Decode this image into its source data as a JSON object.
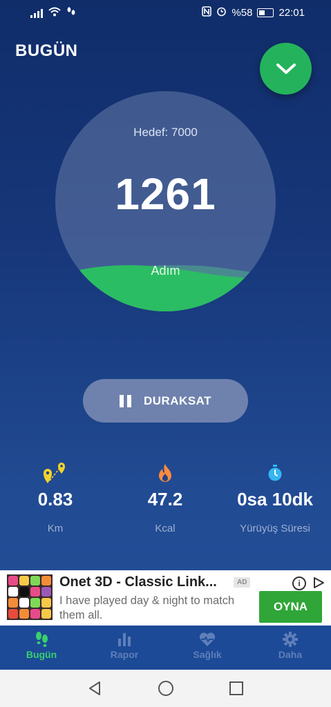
{
  "status_bar": {
    "battery_text": "%58",
    "time": "22:01",
    "icons": [
      "signal-icon",
      "wifi-icon",
      "steps-notification-icon",
      "nfc-icon",
      "alarm-icon",
      "battery-icon"
    ]
  },
  "header": {
    "title": "BUGÜN"
  },
  "progress": {
    "goal_label": "Hedef: 7000",
    "steps": "1261",
    "unit": "Adım",
    "goal_value": 7000,
    "steps_value": 1261,
    "fill_color": "#2bbd63"
  },
  "pause_button": {
    "label": "DURAKSAT"
  },
  "stats": [
    {
      "value": "0.83",
      "label": "Km",
      "icon": "distance-pin-icon",
      "color": "#f2d32c"
    },
    {
      "value": "47.2",
      "label": "Kcal",
      "icon": "flame-icon",
      "color": "#ff8a3d"
    },
    {
      "value": "0sa 10dk",
      "label": "Yürüyüş Süresi",
      "icon": "stopwatch-icon",
      "color": "#35b6f2"
    }
  ],
  "ad": {
    "title": "Onet 3D - Classic Link...",
    "badge": "AD",
    "description": "I have played day & night to match them all.",
    "cta": "OYNA",
    "info_symbol": "i"
  },
  "tabs": [
    {
      "label": "Bugün",
      "icon": "footsteps-icon",
      "active": true
    },
    {
      "label": "Rapor",
      "icon": "bar-chart-icon",
      "active": false
    },
    {
      "label": "Sağlık",
      "icon": "heart-pulse-icon",
      "active": false
    },
    {
      "label": "Daha",
      "icon": "gear-icon",
      "active": false
    }
  ],
  "colors": {
    "accent_green": "#24b35c",
    "active_tab": "#39d06b",
    "inactive_tab": "#5f7fb9",
    "background_top": "#102d6a",
    "background_bottom": "#24519a"
  }
}
